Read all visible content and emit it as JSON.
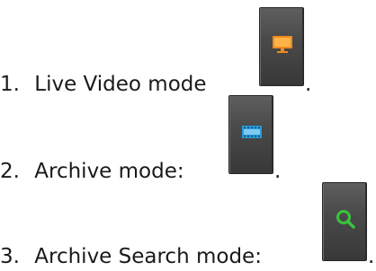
{
  "items": [
    {
      "number": "1.",
      "text": "Live Video mode",
      "punct": ".",
      "icon": "monitor-icon",
      "icon_color": "#f08a1c"
    },
    {
      "number": "2.",
      "text": "Archive mode:",
      "punct": ".",
      "icon": "film-strip-icon",
      "icon_color": "#2a9ad8"
    },
    {
      "number": "3.",
      "text": "Archive Search mode:",
      "punct": ".",
      "icon": "magnifier-icon",
      "icon_color": "#39c43c"
    }
  ]
}
